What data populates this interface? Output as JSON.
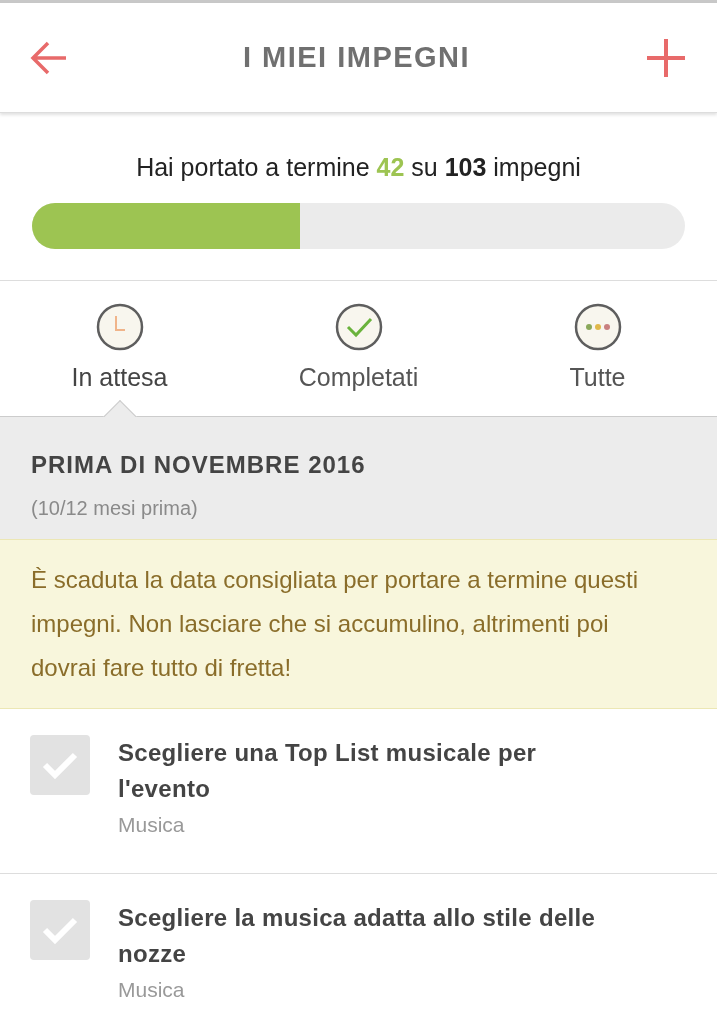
{
  "header": {
    "title": "I MIEI IMPEGNI"
  },
  "summary": {
    "prefix": "Hai portato a termine",
    "done": "42",
    "middle": "su",
    "total": "103",
    "suffix": "impegni",
    "level": 0.41
  },
  "tabs": [
    {
      "label": "In attesa",
      "kind": "pending",
      "selected": true
    },
    {
      "label": "Completati",
      "kind": "done",
      "selected": false
    },
    {
      "label": "Tutte",
      "kind": "all",
      "selected": false
    }
  ],
  "section": {
    "title": "PRIMA DI NOVEMBRE 2016",
    "subtitle": "(10/12 mesi prima)"
  },
  "warning": "È scaduta la data consigliata per portare a termine questi impegni. Non lasciare che si accumulino, altrimenti poi dovrai fare tutto di fretta!",
  "tasks": [
    {
      "title": "Scegliere una Top List musicale per l'evento",
      "category": "Musica",
      "checked": false
    },
    {
      "title": "Scegliere la musica adatta allo stile delle nozze",
      "category": "Musica",
      "checked": false
    }
  ]
}
